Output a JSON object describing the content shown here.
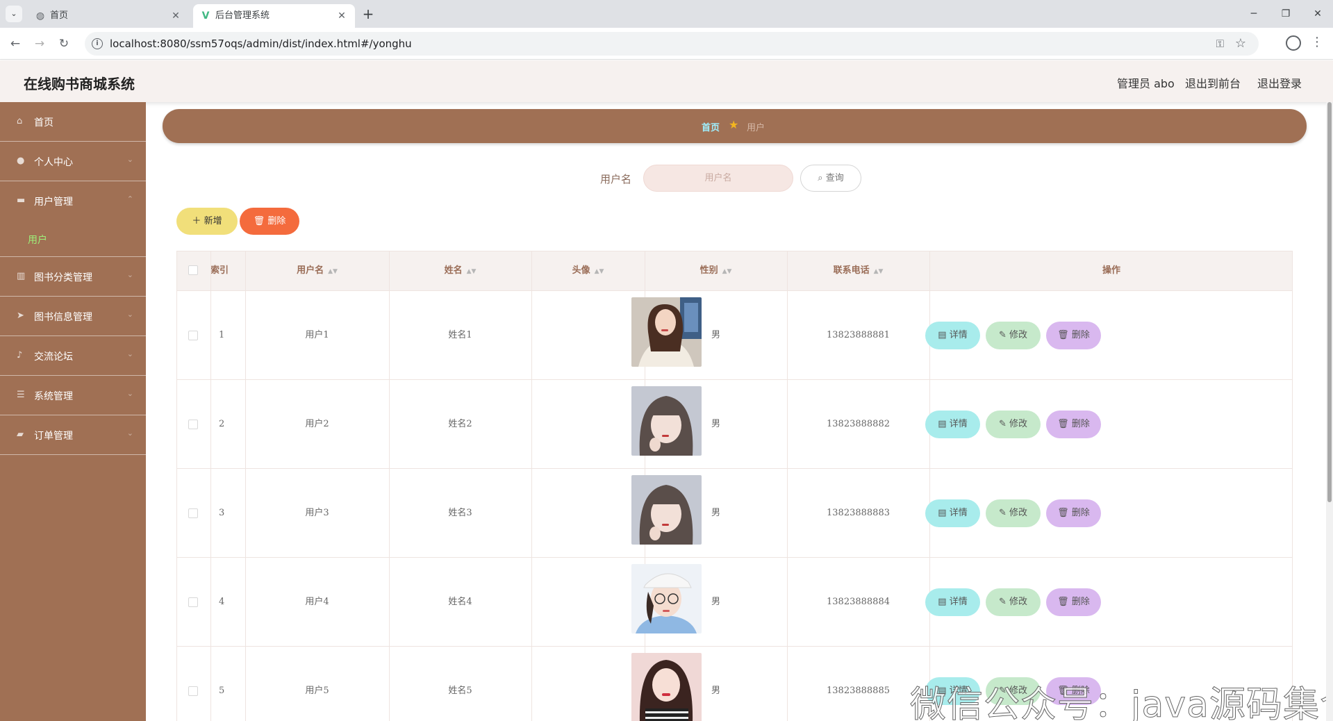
{
  "browser": {
    "tabs": [
      {
        "title": "首页",
        "active": false
      },
      {
        "title": "后台管理系统",
        "active": true
      }
    ],
    "url": "localhost:8080/ssm57oqs/admin/dist/index.html#/yonghu"
  },
  "header": {
    "title": "在线购书商城系统",
    "admin": "管理员 abo",
    "to_front": "退出到前台",
    "logout": "退出登录"
  },
  "sidebar": {
    "items": [
      {
        "label": "首页",
        "icon": "home-icon"
      },
      {
        "label": "个人中心",
        "icon": "person-icon"
      },
      {
        "label": "用户管理",
        "icon": "folder-icon",
        "expanded": true
      },
      {
        "label": "图书分类管理",
        "icon": "book-icon"
      },
      {
        "label": "图书信息管理",
        "icon": "send-icon"
      },
      {
        "label": "交流论坛",
        "icon": "mic-icon"
      },
      {
        "label": "系统管理",
        "icon": "list-icon"
      },
      {
        "label": "订单管理",
        "icon": "cart-icon"
      }
    ],
    "sub_item": "用户"
  },
  "breadcrumb": {
    "home": "首页",
    "current": "用户"
  },
  "search": {
    "label": "用户名",
    "placeholder": "用户名",
    "button": "查询"
  },
  "actions": {
    "add": "新增",
    "delete": "删除"
  },
  "table": {
    "columns": [
      "索引",
      "用户名",
      "姓名",
      "头像",
      "性别",
      "联系电话",
      "操作"
    ],
    "rows": [
      {
        "index": "1",
        "username": "用户1",
        "name": "姓名1",
        "gender": "男",
        "phone": "13823888881"
      },
      {
        "index": "2",
        "username": "用户2",
        "name": "姓名2",
        "gender": "男",
        "phone": "13823888882"
      },
      {
        "index": "3",
        "username": "用户3",
        "name": "姓名3",
        "gender": "男",
        "phone": "13823888883"
      },
      {
        "index": "4",
        "username": "用户4",
        "name": "姓名4",
        "gender": "男",
        "phone": "13823888884"
      },
      {
        "index": "5",
        "username": "用户5",
        "name": "姓名5",
        "gender": "男",
        "phone": "13823888885"
      }
    ],
    "row_actions": {
      "detail": "详情",
      "edit": "修改",
      "delete": "删除"
    }
  },
  "watermark": "微信公众号：java源码集合",
  "colors": {
    "sidebar": "#a07054",
    "breadcrumb_bar": "#a07054",
    "add_button": "#f1df7a",
    "delete_button": "#f46b3d",
    "detail_button": "#a8ecec",
    "edit_button": "#c6e9cb",
    "row_delete_button": "#d9b8ef",
    "active_submenu": "#9ef07a"
  }
}
